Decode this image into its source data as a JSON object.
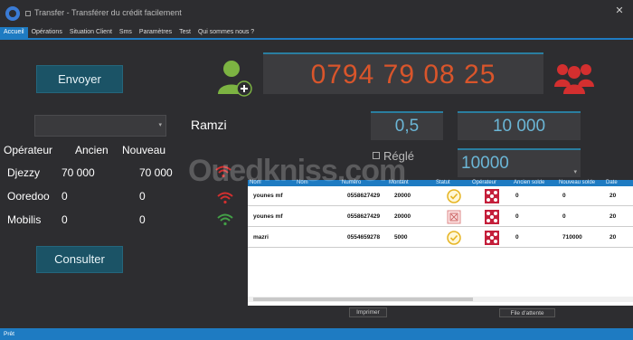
{
  "window": {
    "title": "Transfer - Transférer du crédit facilement",
    "close_glyph": "✕"
  },
  "menu": [
    "Accueil",
    "Opérations",
    "Situation Client",
    "Sms",
    "Paramètres",
    "Test",
    "Qui sommes nous ?"
  ],
  "buttons": {
    "send": "Envoyer",
    "consult": "Consulter",
    "print": "Imprimer",
    "queue": "File d'attente"
  },
  "operators_table": {
    "headers": [
      "Opérateur",
      "Ancien",
      "Nouveau"
    ],
    "rows": [
      {
        "name": "Djezzy",
        "old": "70 000",
        "new": "70 000"
      },
      {
        "name": "Ooredoo",
        "old": "0",
        "new": "0"
      },
      {
        "name": "Mobilis",
        "old": "0",
        "new": "0"
      }
    ]
  },
  "client_name": "Ramzi",
  "phone_number": "0794 79 08 25",
  "rate_value": "0,5",
  "amount_value": "10 000",
  "settled_label": "Réglé",
  "amount_select_value": "10000",
  "watermark": "Ouedkniss.com",
  "grid": {
    "headers": [
      "Nom",
      "Nom",
      "Numéro",
      "Montant",
      "Statut",
      "Opérateur",
      "Ancien solde",
      "Nouveau solde",
      "Date"
    ],
    "rows": [
      {
        "nom": "younes mf",
        "numero": "0558627429",
        "montant": "20000",
        "status": "ok",
        "ancien": "0",
        "nouveau": "0",
        "date": "20"
      },
      {
        "nom": "younes mf",
        "numero": "0558627429",
        "montant": "20000",
        "status": "pending",
        "ancien": "0",
        "nouveau": "0",
        "date": "20"
      },
      {
        "nom": "mazri",
        "numero": "0554659278",
        "montant": "5000",
        "status": "ok",
        "ancien": "0",
        "nouveau": "710000",
        "date": "20"
      }
    ]
  },
  "status_bar": "Prêt",
  "colors": {
    "accent": "#1e7bc2",
    "phone_digits": "#d9552b",
    "button": "#1b5366",
    "user_icon": "#7cb342",
    "group_icon": "#d32f2f",
    "signal_red": "#d32f2f",
    "signal_green": "#43a047"
  }
}
